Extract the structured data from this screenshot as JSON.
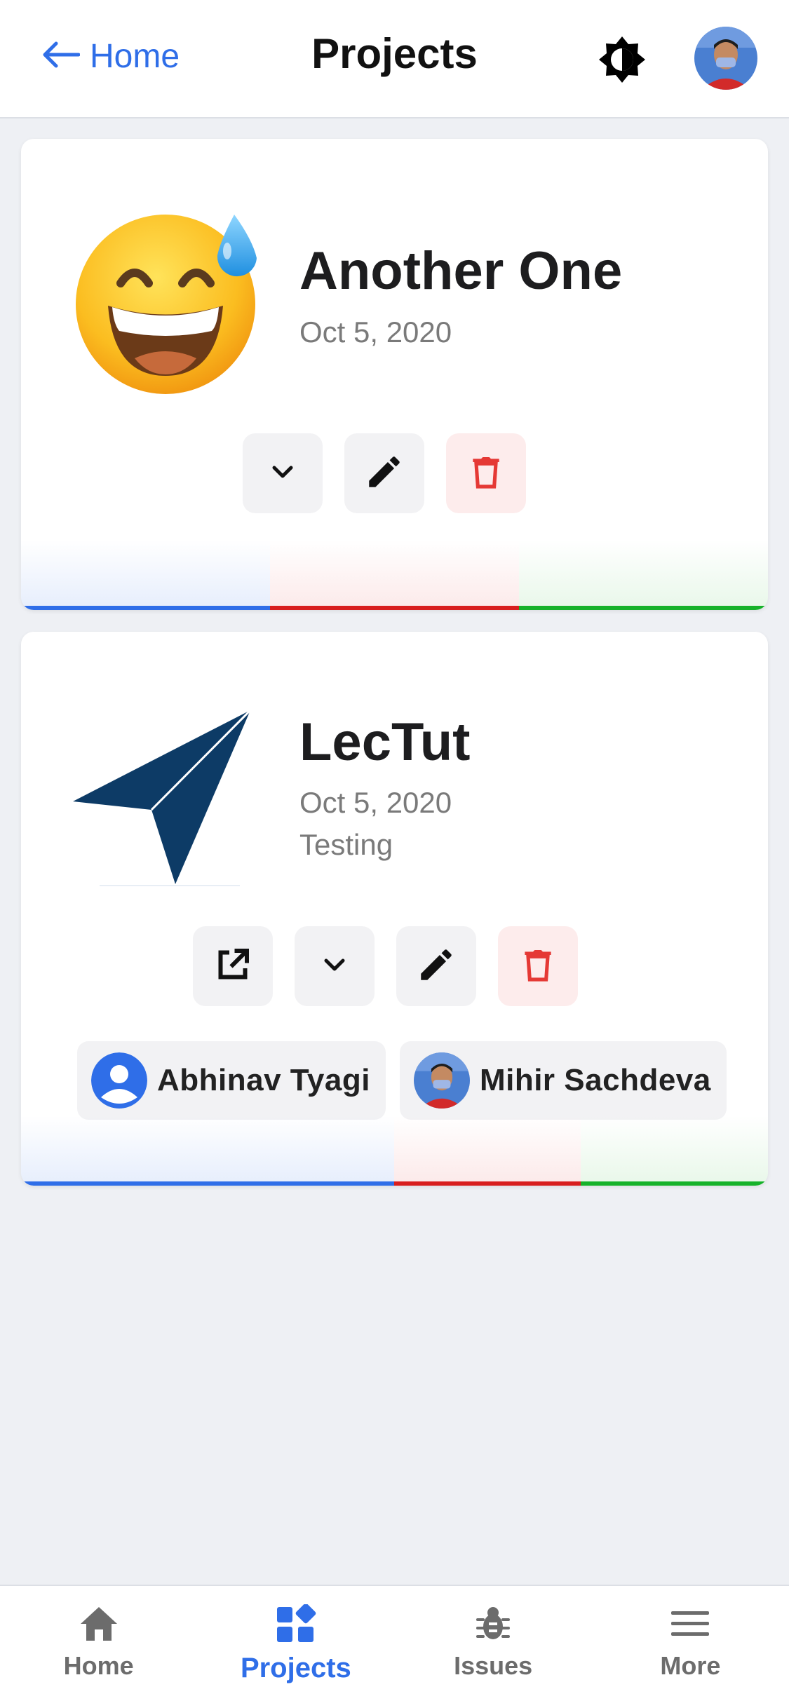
{
  "header": {
    "back_label": "Home",
    "title": "Projects"
  },
  "projects": [
    {
      "title": "Another One",
      "date": "Oct 5, 2020",
      "thumb_icon": "grinning-sweat-emoji"
    },
    {
      "title": "LecTut",
      "date": "Oct 5, 2020",
      "description": "Testing",
      "thumb_icon": "paper-plane-logo",
      "members": [
        {
          "name": "Abhinav Tyagi",
          "avatar": "default-user-icon"
        },
        {
          "name": "Mihir Sachdeva",
          "avatar": "user-photo"
        }
      ]
    }
  ],
  "nav": {
    "items": [
      {
        "label": "Home",
        "icon": "home-icon"
      },
      {
        "label": "Projects",
        "icon": "projects-icon"
      },
      {
        "label": "Issues",
        "icon": "bug-icon"
      },
      {
        "label": "More",
        "icon": "menu-icon"
      }
    ],
    "active": "Projects"
  },
  "colors": {
    "accent": "#2f6ee8",
    "danger": "#e53935",
    "stripe_blue": "#2f6ee8",
    "stripe_red": "#d81e1e",
    "stripe_green": "#16b22a",
    "logo_navy": "#0d3b66"
  }
}
